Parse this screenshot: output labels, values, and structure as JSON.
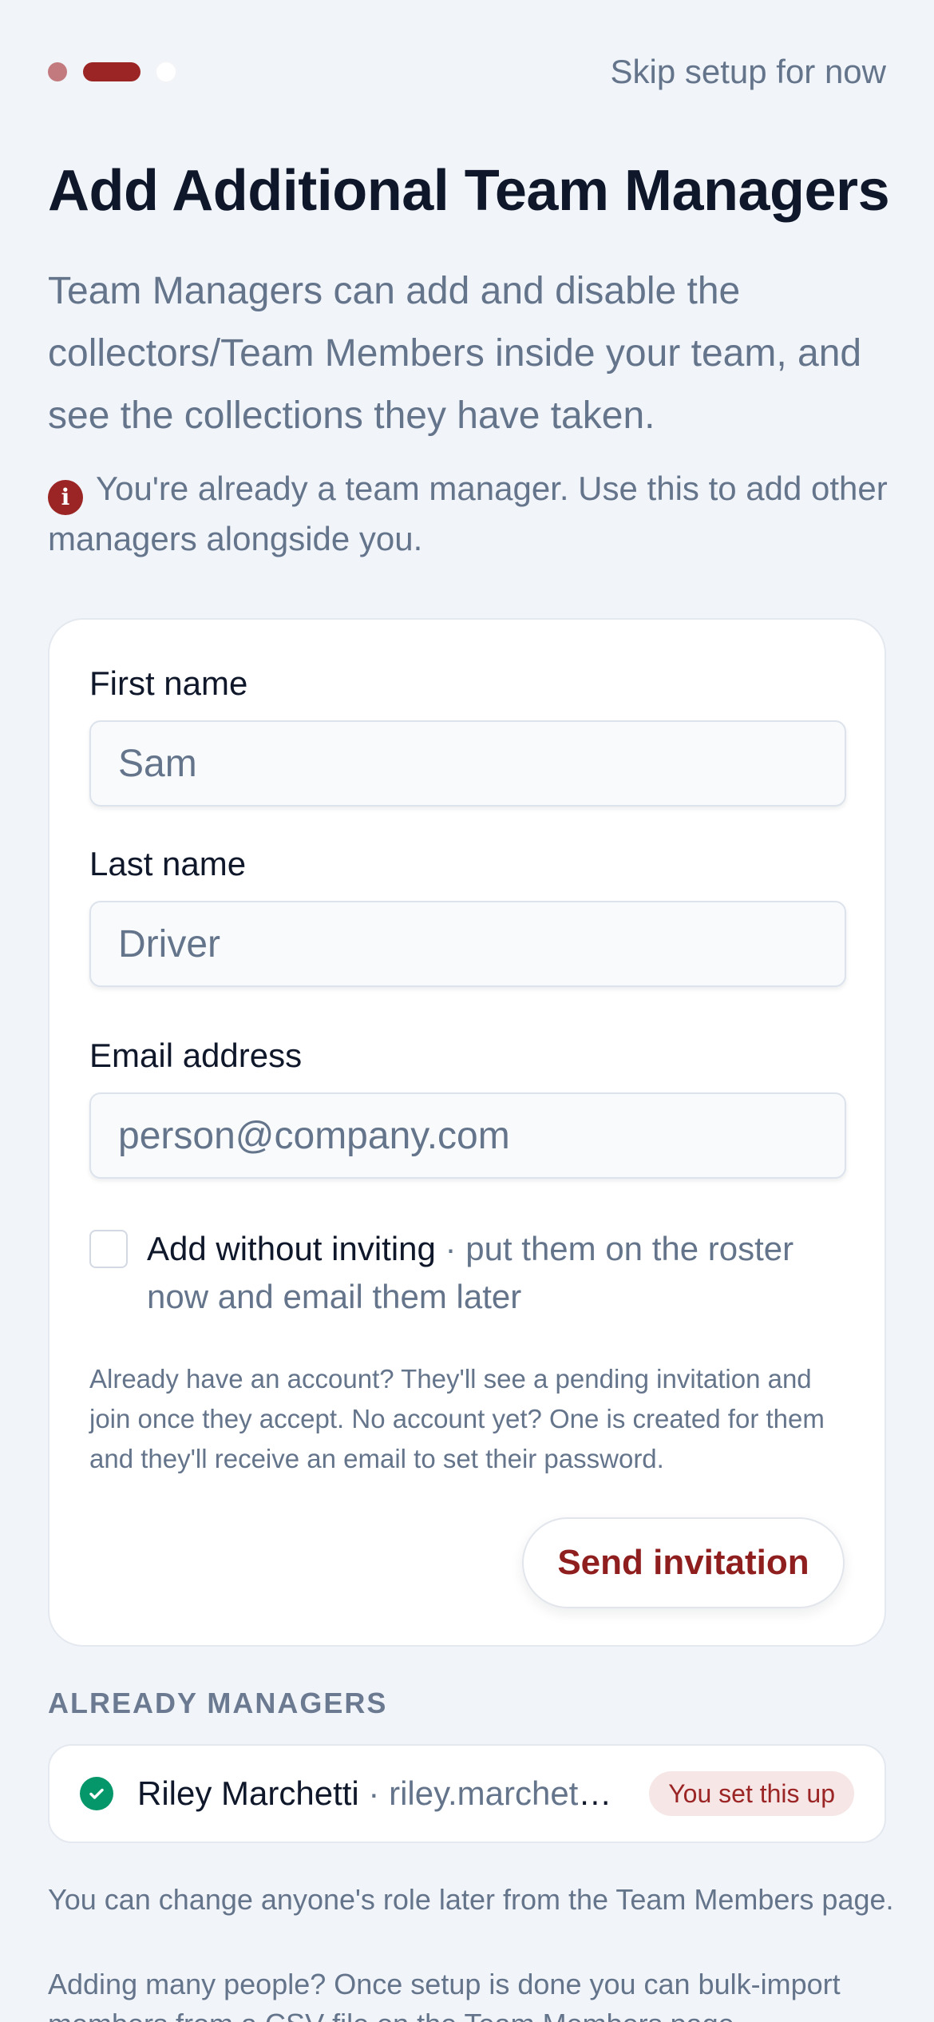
{
  "header": {
    "skip_label": "Skip setup for now",
    "steps": [
      "done",
      "active",
      "todo"
    ]
  },
  "title": "Add Additional Team Managers",
  "intro": "Team Managers can add and disable the collectors/Team Members inside your team, and see the collections they have taken.",
  "notice": {
    "icon": "info-icon",
    "text": "You're already a team manager. Use this to add other managers alongside you."
  },
  "form": {
    "first_name_label": "First name",
    "first_name_value": "Sam",
    "last_name_label": "Last name",
    "last_name_value": "Driver",
    "email_label": "Email address",
    "email_placeholder": "person@company.com",
    "add_without_inviting": {
      "checked": false,
      "label": "Add without inviting",
      "separator": " · ",
      "description": "put them on the roster now and email them later"
    },
    "help_text": "Already have an account? They'll see a pending invitation and join once they accept. No account yet? One is created for them and they'll receive an email to set their password.",
    "send_button_label": "Send invitation"
  },
  "managers": {
    "section_label": "ALREADY MANAGERS",
    "items": [
      {
        "name": "Riley Marchetti",
        "separator": " · ",
        "email": "riley.marchetti@company.com",
        "badge": "You set this up"
      }
    ]
  },
  "footer": {
    "role_note": "You can change anyone's role later from the Team Members page.",
    "bulk_note": "Adding many people? Once setup is done you can bulk-import members from a CSV file on the Team Members page."
  },
  "colors": {
    "accent": "#9b2424",
    "success": "#059669",
    "background": "#f1f4f9"
  }
}
